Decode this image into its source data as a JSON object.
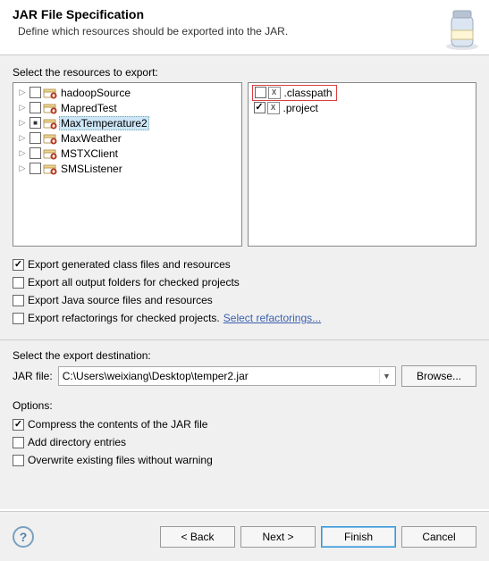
{
  "header": {
    "title": "JAR File Specification",
    "subtitle": "Define which resources should be exported into the JAR."
  },
  "resources": {
    "label": "Select the resources to export:",
    "tree": [
      {
        "label": "hadoopSource",
        "expanded": false,
        "checked": "none",
        "selected": false
      },
      {
        "label": "MapredTest",
        "expanded": false,
        "checked": "none",
        "selected": false
      },
      {
        "label": "MaxTemperature2",
        "expanded": false,
        "checked": "filled",
        "selected": true
      },
      {
        "label": "MaxWeather",
        "expanded": false,
        "checked": "none",
        "selected": false
      },
      {
        "label": "MSTXClient",
        "expanded": false,
        "checked": "none",
        "selected": false
      },
      {
        "label": "SMSListener",
        "expanded": false,
        "checked": "none",
        "selected": false
      }
    ],
    "files": [
      {
        "label": ".classpath",
        "checked": false,
        "highlighted": true,
        "iconLetter": "X"
      },
      {
        "label": ".project",
        "checked": true,
        "highlighted": false,
        "iconLetter": "X"
      }
    ]
  },
  "exportOptions": [
    {
      "label": "Export generated class files and resources",
      "checked": true
    },
    {
      "label": "Export all output folders for checked projects",
      "checked": false
    },
    {
      "label": "Export Java source files and resources",
      "checked": false
    },
    {
      "label": "Export refactorings for checked projects.",
      "checked": false,
      "linkLabel": "Select refactorings..."
    }
  ],
  "destination": {
    "groupLabel": "Select the export destination:",
    "fieldLabel": "JAR file:",
    "value": "C:\\Users\\weixiang\\Desktop\\temper2.jar",
    "browseLabel": "Browse..."
  },
  "options": {
    "groupLabel": "Options:",
    "items": [
      {
        "label": "Compress the contents of the JAR file",
        "checked": true
      },
      {
        "label": "Add directory entries",
        "checked": false
      },
      {
        "label": "Overwrite existing files without warning",
        "checked": false
      }
    ]
  },
  "footer": {
    "back": "< Back",
    "next": "Next >",
    "finish": "Finish",
    "cancel": "Cancel"
  }
}
